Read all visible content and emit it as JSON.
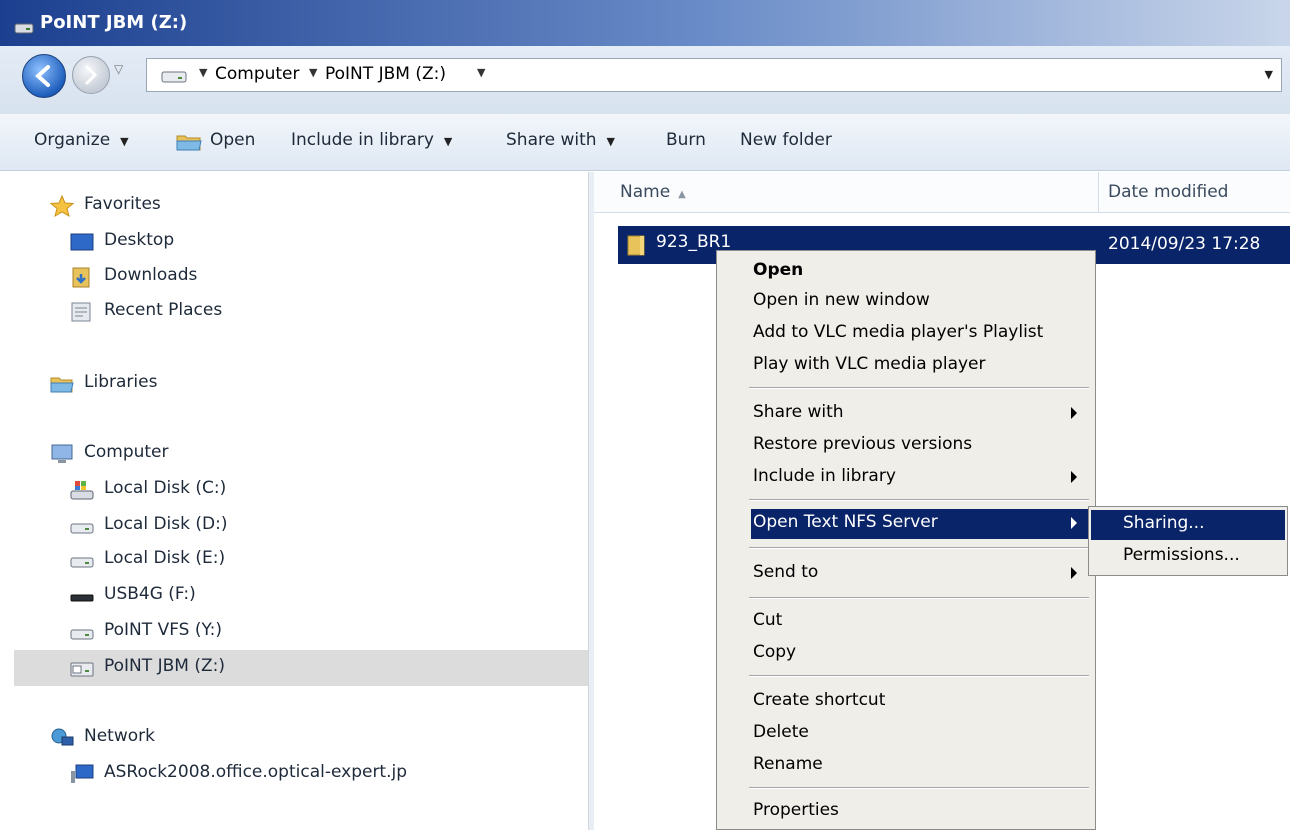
{
  "window": {
    "title": "PoINT JBM (Z:)"
  },
  "address": {
    "crumbs": [
      "Computer",
      "PoINT JBM (Z:)"
    ]
  },
  "toolbar": {
    "organize": "Organize",
    "open": "Open",
    "include_in_library": "Include in library",
    "share_with": "Share with",
    "burn": "Burn",
    "new_folder": "New folder"
  },
  "nav": {
    "favorites": "Favorites",
    "desktop": "Desktop",
    "downloads": "Downloads",
    "recent_places": "Recent Places",
    "libraries": "Libraries",
    "computer": "Computer",
    "local_disk_c": "Local Disk (C:)",
    "local_disk_d": "Local Disk (D:)",
    "local_disk_e": "Local Disk (E:)",
    "usb4g": "USB4G (F:)",
    "point_vfs": "PoINT VFS (Y:)",
    "point_jbm": "PoINT JBM (Z:)",
    "network": "Network",
    "asrock": "ASRock2008.office.optical-expert.jp"
  },
  "columns": {
    "name": "Name",
    "date_modified": "Date modified"
  },
  "files": [
    {
      "name": "923_BR1",
      "date": "2014/09/23 17:28"
    }
  ],
  "context_menu": {
    "open": "Open",
    "open_new_window": "Open in new window",
    "add_vlc_playlist": "Add to VLC media player's Playlist",
    "play_vlc": "Play with VLC media player",
    "share_with": "Share with",
    "restore_versions": "Restore previous versions",
    "include_in_library": "Include in library",
    "open_text_nfs": "Open Text NFS Server",
    "send_to": "Send to",
    "cut": "Cut",
    "copy": "Copy",
    "create_shortcut": "Create shortcut",
    "delete": "Delete",
    "rename": "Rename",
    "properties": "Properties"
  },
  "submenu": {
    "sharing": "Sharing...",
    "permissions": "Permissions..."
  },
  "colors": {
    "selection": "#0a246a",
    "menu_bg": "#f0eee9"
  }
}
